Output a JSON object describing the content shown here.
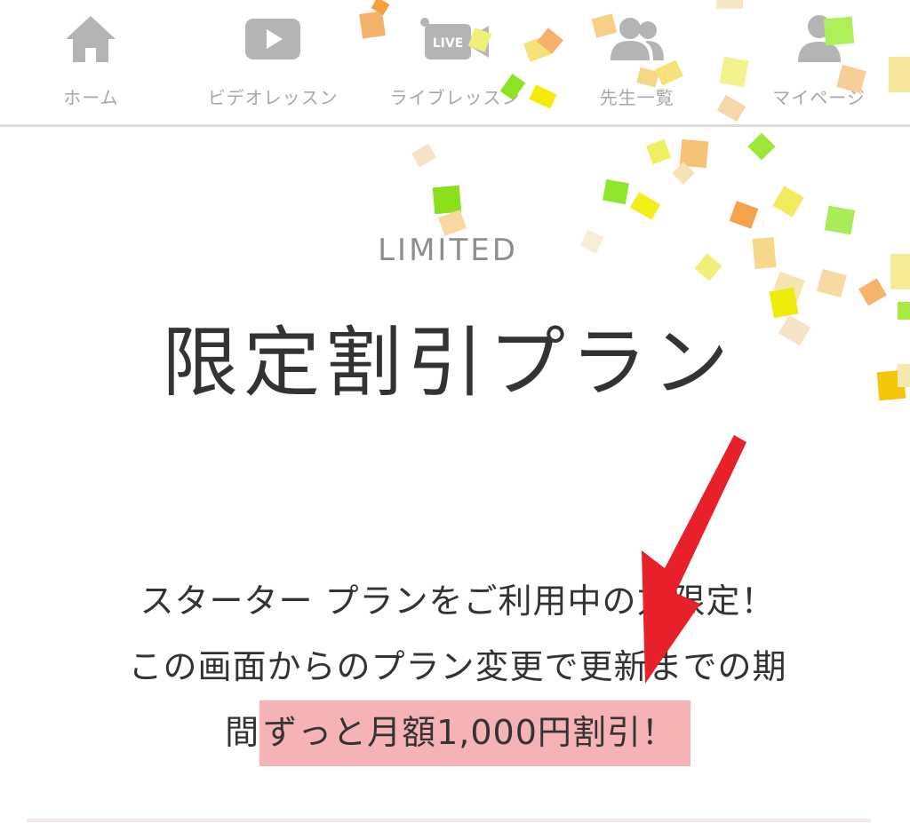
{
  "nav": {
    "items": [
      {
        "label": "ホーム",
        "icon": "home-icon"
      },
      {
        "label": "ビデオレッスン",
        "icon": "play-icon"
      },
      {
        "label": "ライブレッスン",
        "icon": "live-camera-icon",
        "badge": "LIVE"
      },
      {
        "label": "先生一覧",
        "icon": "teachers-icon"
      },
      {
        "label": "マイページ",
        "icon": "person-icon"
      }
    ]
  },
  "main": {
    "kicker": "LIMITED",
    "title": "限定割引プラン",
    "description_line1": "スターター プランをご利用中の方限定！",
    "description_line2": "この画面からのプラン変更で更新までの期",
    "description_line3_prefix": "間",
    "description_highlight": "ずっと月額1,000円割引！"
  },
  "colors": {
    "nav_icon": "#b4b4b4",
    "nav_label": "#a7a7a7",
    "highlight_bg": "#f5b3b5",
    "arrow": "#e8202a",
    "text": "#333333"
  }
}
